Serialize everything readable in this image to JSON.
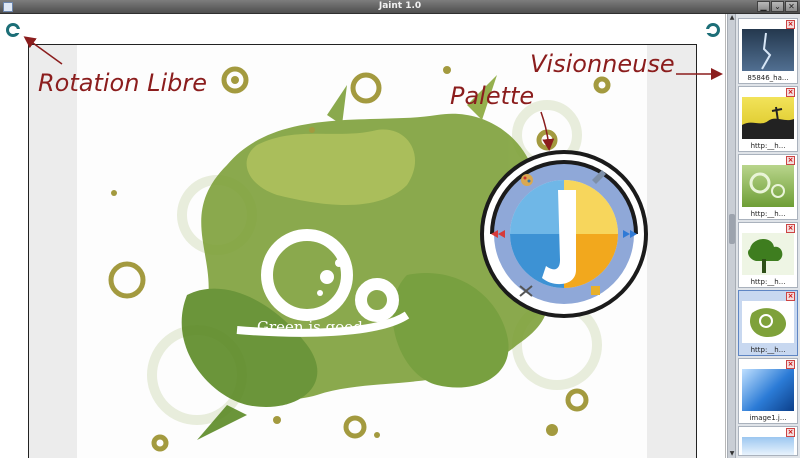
{
  "window": {
    "title": "Jaint 1.0",
    "controls": [
      "minimize",
      "maximize",
      "close"
    ]
  },
  "annotations": {
    "rotation": "Rotation Libre",
    "palette": "Palette",
    "viewer": "Visionneuse"
  },
  "artwork": {
    "tagline": "Green is good."
  },
  "palette_tools": [
    "palette-icon",
    "edit-icon",
    "forward-arrow-icon",
    "puzzle-icon",
    "tools-icon",
    "back-arrow-icon"
  ],
  "viewer": {
    "thumbnails": [
      {
        "caption": "85846_ha...",
        "style": "dark-blue",
        "selected": false
      },
      {
        "caption": "http:__h...",
        "style": "yellow-silhouette",
        "selected": false
      },
      {
        "caption": "http:__h...",
        "style": "green-swirl",
        "selected": false
      },
      {
        "caption": "http:__h...",
        "style": "green-tree",
        "selected": false
      },
      {
        "caption": "http:__h...",
        "style": "green-is-good",
        "selected": true
      },
      {
        "caption": "image1.j...",
        "style": "blue-gradient",
        "selected": false
      },
      {
        "caption": "",
        "style": "sky",
        "selected": false
      }
    ]
  },
  "colors": {
    "accent_red": "#8b1d1d",
    "olive": "#a39a3f",
    "green": "#6f9a2c",
    "palette_ring": "#8fa8d8"
  }
}
